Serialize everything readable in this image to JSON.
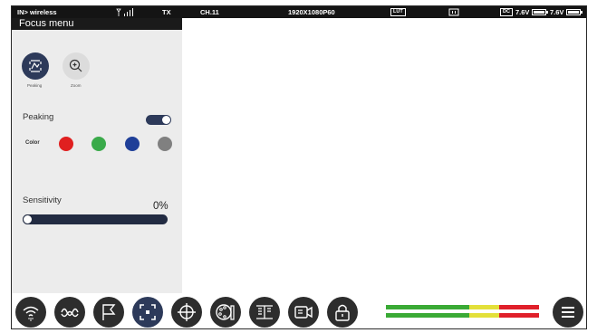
{
  "status": {
    "input": "IN> wireless",
    "tx": "TX",
    "channel": "CH.11",
    "format": "1920X1080P60",
    "lut": "LUT",
    "dc": "DC",
    "voltage1": "7.6V",
    "voltage2": "7.6V"
  },
  "panel": {
    "title": "Focus menu",
    "modes": [
      {
        "label": "Peaking",
        "icon": "peaking-icon",
        "active": true
      },
      {
        "label": "Zoom",
        "icon": "zoom-icon",
        "active": false
      }
    ],
    "peaking_label": "Peaking",
    "peaking_on": true,
    "color_label": "Color",
    "colors": [
      "#e02020",
      "#3aaa4a",
      "#1f3f98",
      "#808080"
    ],
    "sensitivity_label": "Sensitivity",
    "sensitivity_value": "0%"
  },
  "toolbar": {
    "icons": [
      "wifi-icon",
      "waveform-icon",
      "flag-icon",
      "focus-icon",
      "crosshair-icon",
      "color-palette-icon",
      "split-screen-icon",
      "record-icon",
      "lock-icon",
      "menu-icon"
    ],
    "active_icon": "focus-icon",
    "colors": {
      "button": "#2d2d2d",
      "active": "#2d3a5a",
      "green": "#3aaa35",
      "yellow": "#e3e03a",
      "red": "#e0202a"
    }
  }
}
